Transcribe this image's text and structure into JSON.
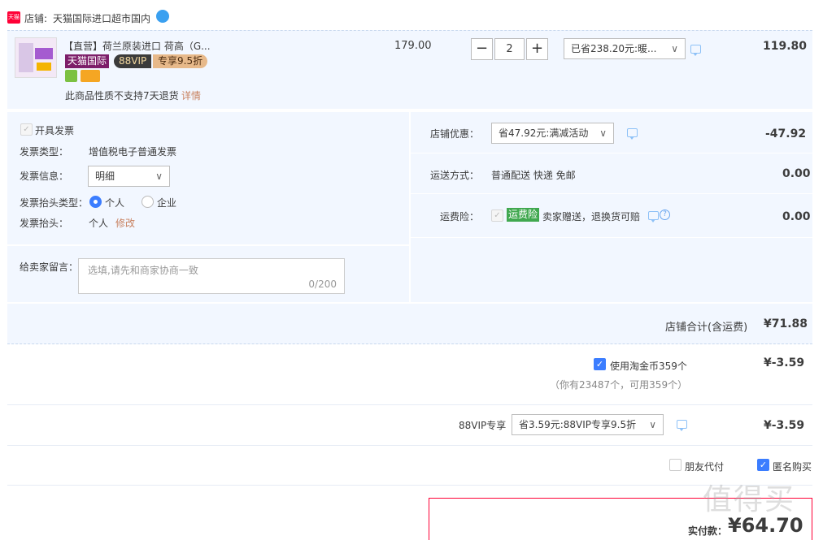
{
  "shop": {
    "brand_icon_label": "天猫",
    "label": "店铺:",
    "name": "天猫国际进口超市国内",
    "chat_icon": "chat-bubble-icon"
  },
  "item": {
    "title": "【直营】荷兰原装进口 荷高（G...",
    "badge_tmall_intl": "天猫国际",
    "badge_88vip": "88VIP",
    "badge_discount": "专享9.5折",
    "unit_price": "179.00",
    "quantity": "2",
    "minus": "−",
    "plus": "+",
    "promo_select": "已省238.20元:暖...",
    "subtotal": "119.80",
    "return_note": "此商品性质不支持7天退货",
    "return_detail_link": "详情"
  },
  "invoice": {
    "enable_label": "开具发票",
    "type_label": "发票类型：",
    "type_value": "增值税电子普通发票",
    "info_label": "发票信息：",
    "info_value": "明细",
    "header_type_label": "发票抬头类型：",
    "header_type_personal": "个人",
    "header_type_company": "企业",
    "header_label": "发票抬头：",
    "header_value": "个人",
    "modify_link": "修改"
  },
  "message": {
    "label": "给卖家留言：",
    "placeholder": "选填,请先和商家协商一致",
    "counter": "0/200"
  },
  "shop_promo": {
    "label": "店铺优惠：",
    "select": "省47.92元:满减活动",
    "amount": "-47.92"
  },
  "shipping": {
    "label": "运送方式：",
    "value": "普通配送 快递 免邮",
    "amount": "0.00"
  },
  "insurance": {
    "label": "运费险：",
    "tag": "运费险",
    "desc": "卖家赠送，退换货可赔",
    "amount": "0.00"
  },
  "shop_total": {
    "label": "店铺合计(含运费)",
    "amount": "¥71.88"
  },
  "coins": {
    "label": "使用淘金币359个",
    "note": "（你有23487个，可用359个）",
    "amount": "¥-3.59"
  },
  "vip": {
    "label": "88VIP专享",
    "select": "省3.59元:88VIP专享9.5折",
    "amount": "¥-3.59"
  },
  "options": {
    "friend_pay": "朋友代付",
    "anonymous": "匿名购买"
  },
  "payment": {
    "label": "实付款：",
    "amount": "¥64.70"
  },
  "watermark": "值得买",
  "colors": {
    "price_red": "#ff0036",
    "accent_blue": "#3b7dff",
    "row_bg": "#f2f7ff",
    "link_orange": "#c8815f",
    "insurance_green": "#40a84f"
  }
}
